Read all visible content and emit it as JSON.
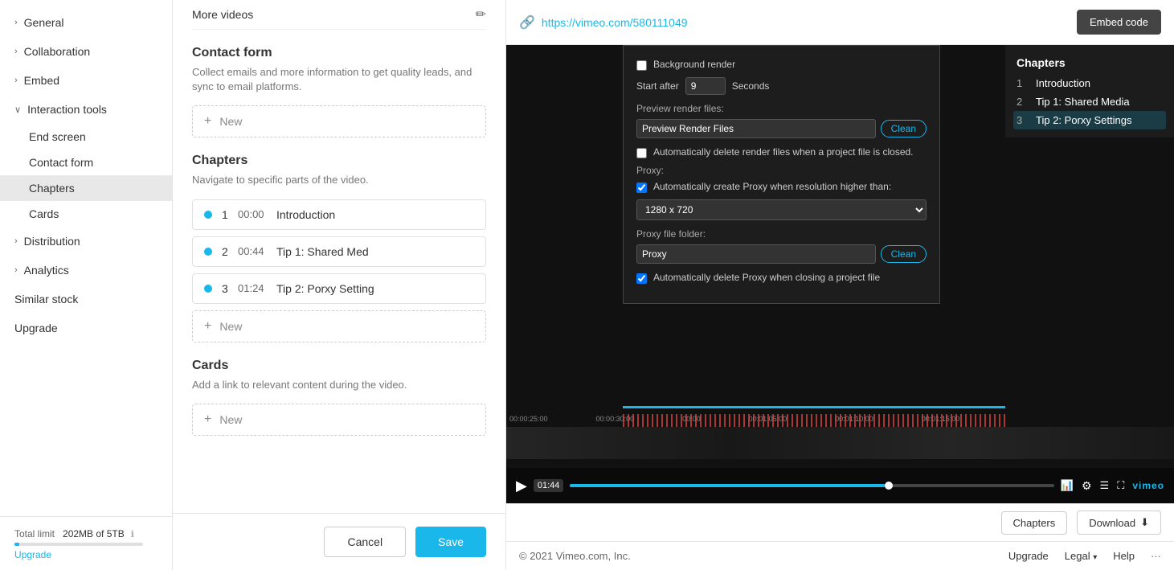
{
  "sidebar": {
    "items": [
      {
        "label": "General",
        "id": "general",
        "expanded": false
      },
      {
        "label": "Collaboration",
        "id": "collaboration",
        "expanded": false
      },
      {
        "label": "Embed",
        "id": "embed",
        "expanded": false
      },
      {
        "label": "Interaction tools",
        "id": "interaction-tools",
        "expanded": true
      }
    ],
    "subitems": [
      {
        "label": "End screen",
        "id": "end-screen"
      },
      {
        "label": "Contact form",
        "id": "contact-form"
      },
      {
        "label": "Chapters",
        "id": "chapters",
        "active": true
      },
      {
        "label": "Cards",
        "id": "cards"
      }
    ],
    "bottom_items": [
      {
        "label": "Distribution",
        "id": "distribution"
      },
      {
        "label": "Analytics",
        "id": "analytics"
      },
      {
        "label": "Similar stock",
        "id": "similar-stock"
      },
      {
        "label": "Upgrade",
        "id": "upgrade"
      }
    ],
    "footer": {
      "total_label": "Total limit",
      "storage_used": "202MB of 5TB",
      "upgrade_label": "Upgrade"
    }
  },
  "middle": {
    "more_videos_label": "More videos",
    "contact_form": {
      "title": "Contact form",
      "description": "Collect emails and more information to get quality leads, and sync to email platforms."
    },
    "chapters": {
      "title": "Chapters",
      "description": "Navigate to specific parts of the video.",
      "items": [
        {
          "num": "1",
          "time": "00:00",
          "title": "Introduction"
        },
        {
          "num": "2",
          "time": "00:44",
          "title": "Tip 1: Shared Med"
        },
        {
          "num": "3",
          "time": "01:24",
          "title": "Tip 2: Porxy Settinɡ"
        }
      ],
      "new_label": "New"
    },
    "cards": {
      "title": "Cards",
      "description": "Add a link to relevant content during the video.",
      "new_label": "New"
    },
    "new_label": "New",
    "cancel_label": "Cancel",
    "save_label": "Save"
  },
  "video_panel": {
    "url": "https://vimeo.com/580111049",
    "embed_code_label": "Embed code",
    "render_settings": {
      "background_render_label": "Background render",
      "start_after_label": "Start after",
      "start_after_value": "9",
      "seconds_label": "Seconds",
      "preview_render_files_label": "Preview render files:",
      "preview_render_files_option": "Preview Render Files",
      "clean_label": "Clean",
      "auto_delete_label": "Automatically delete render files when a project file is closed.",
      "proxy_label": "Proxy:",
      "auto_proxy_label": "Automatically create Proxy when resolution higher than:",
      "resolution_option": "1280 x 720",
      "proxy_file_folder_label": "Proxy file folder:",
      "proxy_folder_option": "Proxy",
      "clean2_label": "Clean",
      "auto_delete_proxy_label": "Automatically delete Proxy when closing a project file"
    },
    "chapters_overlay": {
      "title": "Chapters",
      "items": [
        {
          "num": "1",
          "title": "Introduction"
        },
        {
          "num": "2",
          "title": "Tip 1: Shared Media"
        },
        {
          "num": "3",
          "title": "Tip 2: Porxy Settings"
        }
      ]
    },
    "controls": {
      "time": "01:44",
      "timecodes": [
        "00:00:25:00",
        "00:00:30:00",
        "00:00",
        "00:01:05:00",
        "00:01:10:00",
        "00:01:15:00"
      ]
    },
    "bottom_actions": {
      "chapters_label": "Chapters",
      "download_label": "Download"
    }
  },
  "footer": {
    "copyright": "© 2021 Vimeo.com, Inc.",
    "upgrade_label": "Upgrade",
    "legal_label": "Legal",
    "help_label": "Help"
  }
}
